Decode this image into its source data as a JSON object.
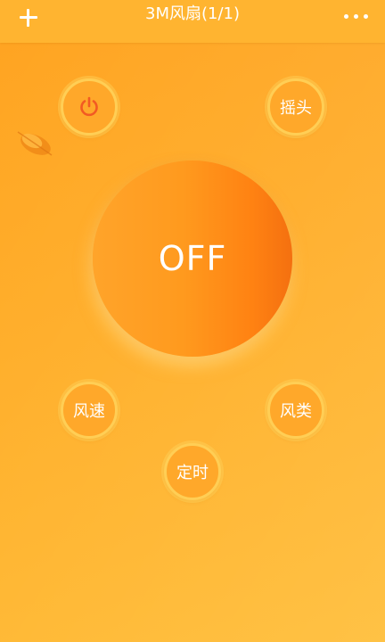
{
  "header": {
    "title": "3M风扇(1/1)",
    "add_icon": "plus-icon",
    "more_icon": "more-dots-icon"
  },
  "controls": {
    "power": {
      "icon": "power-icon",
      "color": "#f25a23"
    },
    "swing": {
      "label": "摇头"
    },
    "main": {
      "label": "OFF"
    },
    "speed": {
      "label": "风速"
    },
    "type": {
      "label": "风类"
    },
    "timer": {
      "label": "定时"
    }
  },
  "colors": {
    "header": "#ffb430",
    "background": "#ffa321",
    "main_circle": "#ff8a16",
    "button_ring": "#ffce55"
  }
}
